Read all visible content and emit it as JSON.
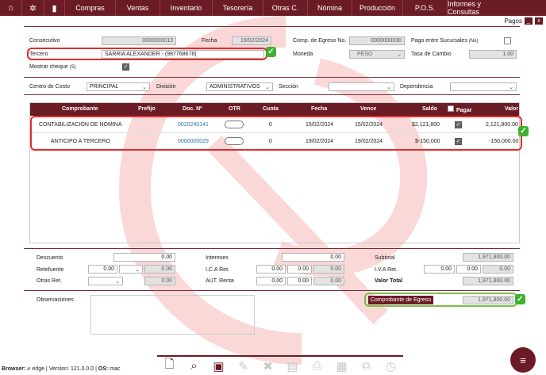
{
  "nav": {
    "menus": [
      "Compras",
      "Ventas",
      "Inventario",
      "Tesorería",
      "Otras C.",
      "Nómina",
      "Producción",
      "P.O.S.",
      "Informes y Consultas"
    ]
  },
  "window": {
    "title": "Pagos",
    "minimize": "_",
    "close": "x"
  },
  "header": {
    "consecutivo_label": "Consecutivo",
    "consecutivo_value": "0000000013",
    "fecha_label": "Fecha",
    "fecha_value": "19/02/2024",
    "comp_label": "Comp. de Egreso No.",
    "comp_value": "0000000030",
    "pago_sucursales_label": "Pago entre Sucursales",
    "pago_sucursales_hint": "(No)",
    "tercero_label": "Tercero",
    "tercero_value": "SARRIA ALEXANDER - (987768678)",
    "moneda_label": "Moneda",
    "moneda_value": "PESO",
    "tasa_label": "Tasa de Cambio",
    "tasa_value": "1.00",
    "mostrar_cheque_label": "Mostrar cheque",
    "mostrar_cheque_hint": "(S)"
  },
  "filters": {
    "centro_label": "Centro de Costo",
    "centro_value": "PRINCIPAL",
    "division_label": "División",
    "division_value": "ADMINISTRATIVOS",
    "seccion_label": "Sección",
    "seccion_value": "",
    "dependencia_label": "Dependencia",
    "dependencia_value": ""
  },
  "grid": {
    "headers": [
      "Comprobante",
      "Prefijo",
      "Doc. Nº",
      "OTR",
      "Cuota",
      "Fecha",
      "Vence",
      "Saldo",
      "Pagar",
      "Valor"
    ],
    "rows": [
      {
        "comprobante": "CONTABILIZACIÓN DE NÓMINA",
        "prefijo": "",
        "doc": "0020240141",
        "cuota": "0",
        "fecha": "15/02/2024",
        "vence": "15/02/2024",
        "saldo": "$2,121,800",
        "valor": "2,121,800.00"
      },
      {
        "comprobante": "ANTICIPO A TERCERO",
        "prefijo": "",
        "doc": "0000000029",
        "cuota": "0",
        "fecha": "19/02/2024",
        "vence": "19/02/2024",
        "saldo": "$-150,000",
        "valor": "-150,000.00"
      }
    ]
  },
  "totals": {
    "descuento_label": "Descuento",
    "descuento_value": "0.00",
    "retefuente_label": "Retefuente",
    "retefuente_pct": "0.00",
    "retefuente_value": "0.00",
    "otras_ret_label": "Otras Ret.",
    "otras_ret_value": "0.00",
    "intereses_label": "Intereses",
    "intereses_value": "0.00",
    "ica_label": "I.C.A Ret.",
    "ica_pct": "0.00",
    "ica_base": "0.00",
    "ica_value": "0.00",
    "aut_renta_label": "AUT. Renta",
    "aut_renta_pct": "0.00",
    "aut_renta_base": "0.00",
    "aut_renta_value": "0.00",
    "subtotal_label": "Subtotal",
    "subtotal_value": "1,971,800.00",
    "iva_label": "I.V.A Ret.",
    "iva_pct": "0.00",
    "iva_base": "0.00",
    "iva_value": "0.00",
    "valor_total_label": "Valor Total",
    "valor_total_value": "1,971,800.00"
  },
  "bottom": {
    "observaciones_label": "Observaciones",
    "comprobante_btn": "Comprobante de Egreso",
    "comprobante_value": "1,971,800.00"
  },
  "footer": {
    "browser_label": "Browser:",
    "browser_value": "edge",
    "version_label": "Version:",
    "version_value": "121.0.0.0",
    "os_label": "OS:",
    "os_value": "mac"
  },
  "colors": {
    "brand": "#6b1b24",
    "highlight_red": "#e52b2b",
    "highlight_green": "#76c043",
    "link": "#2a6fb0"
  }
}
